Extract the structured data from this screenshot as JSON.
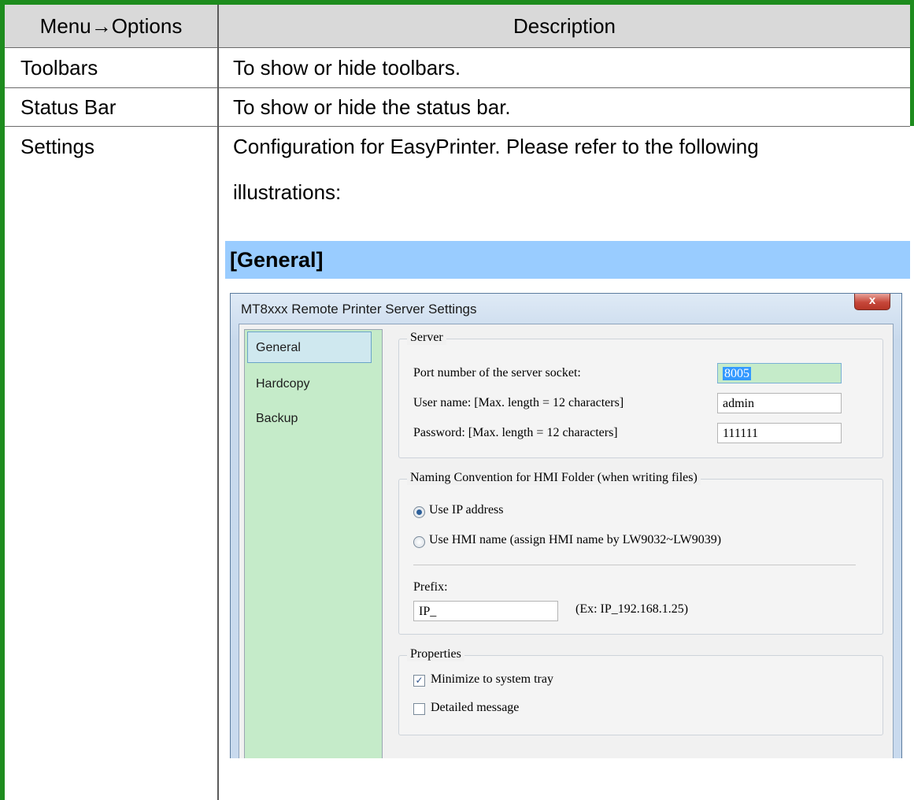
{
  "table": {
    "headers": [
      "Menu→Options",
      "Description"
    ],
    "rows": [
      {
        "option": "Toolbars",
        "description": "To show or hide toolbars."
      },
      {
        "option": "Status Bar",
        "description": "To show or hide the status bar."
      },
      {
        "option": "Settings",
        "description_line1": "Configuration for EasyPrinter. Please refer to the following",
        "description_line2": "illustrations:"
      }
    ]
  },
  "section_heading": "[General]",
  "dialog": {
    "title": "MT8xxx Remote Printer Server Settings",
    "close_label": "x",
    "nav": [
      "General",
      "Hardcopy",
      "Backup"
    ],
    "selected_nav": "General",
    "server": {
      "group_label": "Server",
      "port_label": "Port number of the server socket:",
      "port_value": "8005",
      "user_label": "User name: [Max. length = 12 characters]",
      "user_value": "admin",
      "password_label": "Password: [Max. length = 12 characters]",
      "password_value": "111111"
    },
    "naming": {
      "group_label": "Naming Convention for HMI Folder (when writing files)",
      "option_ip": "Use IP address",
      "option_hmi": "Use HMI name (assign HMI name by LW9032~LW9039)",
      "selected": "ip",
      "prefix_label": "Prefix:",
      "prefix_value": "IP_",
      "prefix_example": "(Ex: IP_192.168.1.25)"
    },
    "properties": {
      "group_label": "Properties",
      "minimize_label": "Minimize to system tray",
      "minimize_checked": true,
      "detailed_label": "Detailed message",
      "detailed_checked": false
    }
  },
  "colors": {
    "border_green": "#1e8c1e",
    "header_gray": "#d9d9d9",
    "section_blue": "#99ccff",
    "nav_green": "#c5ebc9"
  }
}
